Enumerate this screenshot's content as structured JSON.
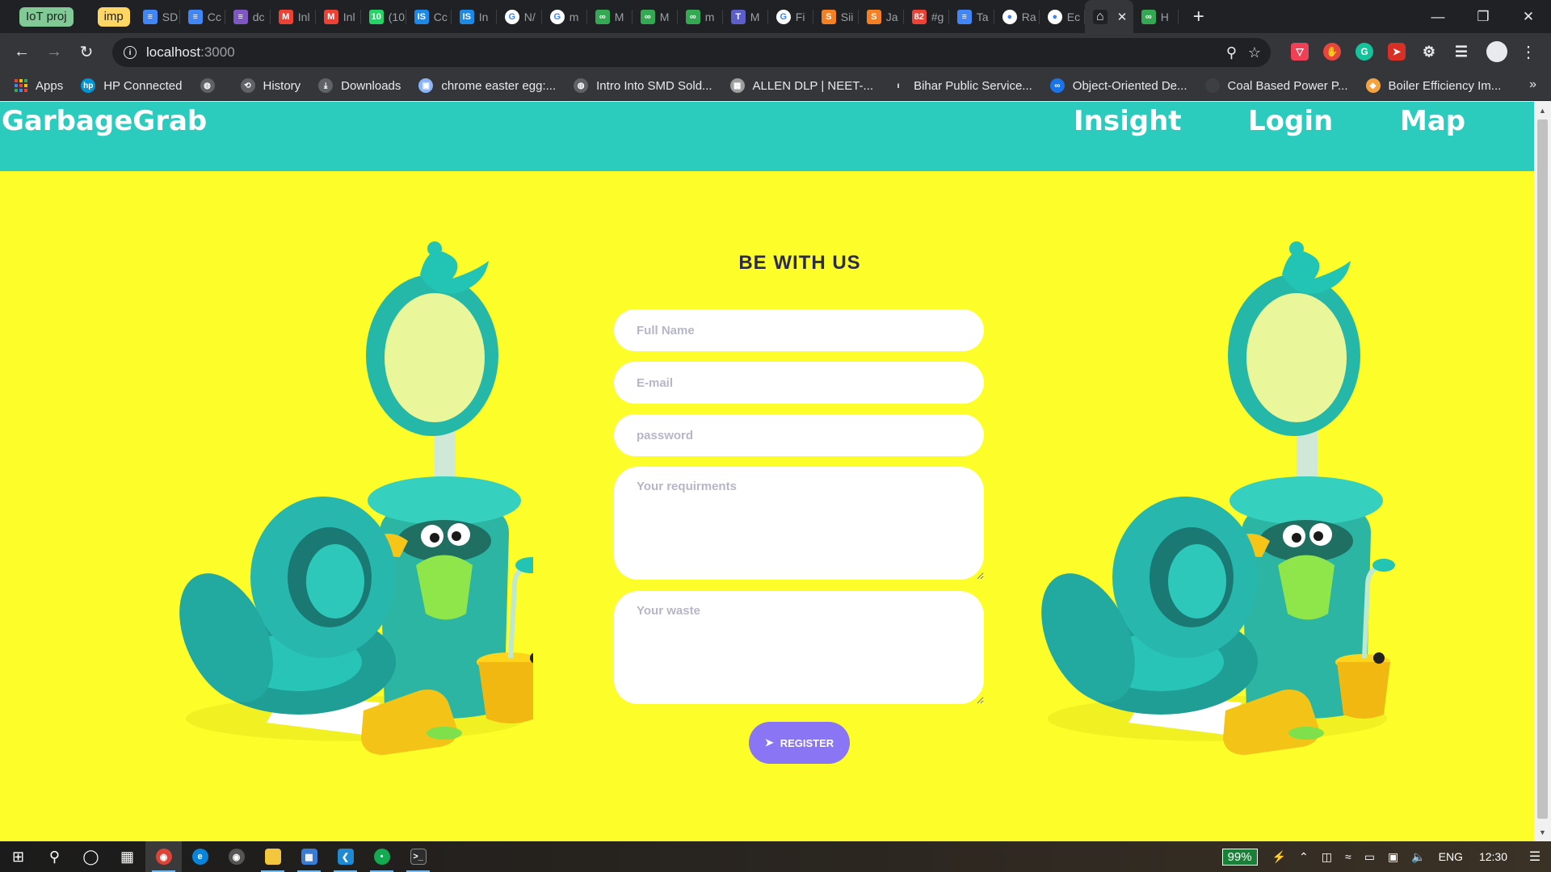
{
  "browser": {
    "tab_groups": [
      "IoT proj",
      "imp"
    ],
    "tabs": [
      {
        "title": "SD",
        "icon": "docs-icon",
        "color": "#4285f4",
        "glyph": "≡"
      },
      {
        "title": "Cc",
        "icon": "docs-icon",
        "color": "#4285f4",
        "glyph": "≡"
      },
      {
        "title": "dc",
        "icon": "forms-icon",
        "color": "#7e57c2",
        "glyph": "≡"
      },
      {
        "title": "Inl",
        "icon": "gmail-icon",
        "color": "#ea4335",
        "glyph": "M"
      },
      {
        "title": "Inl",
        "icon": "gmail-icon",
        "color": "#ea4335",
        "glyph": "M"
      },
      {
        "title": "(10",
        "icon": "whatsapp-icon",
        "color": "#25d366",
        "glyph": "10"
      },
      {
        "title": "Cc",
        "icon": "is-icon",
        "color": "#1e88e5",
        "glyph": "IS"
      },
      {
        "title": "In",
        "icon": "is-icon",
        "color": "#1e88e5",
        "glyph": "IS"
      },
      {
        "title": "N/",
        "icon": "google-icon",
        "color": "#ffffff",
        "glyph": "G"
      },
      {
        "title": "m",
        "icon": "google-icon",
        "color": "#ffffff",
        "glyph": "G"
      },
      {
        "title": "M",
        "icon": "link-icon",
        "color": "#34a853",
        "glyph": "∞"
      },
      {
        "title": "M",
        "icon": "link-icon",
        "color": "#34a853",
        "glyph": "∞"
      },
      {
        "title": "m",
        "icon": "link-icon",
        "color": "#34a853",
        "glyph": "∞"
      },
      {
        "title": "M",
        "icon": "teams-icon",
        "color": "#5b5fc7",
        "glyph": "T"
      },
      {
        "title": "Fi",
        "icon": "google-icon",
        "color": "#ffffff",
        "glyph": "G"
      },
      {
        "title": "Sii",
        "icon": "stackoverflow-icon",
        "color": "#f48024",
        "glyph": "S"
      },
      {
        "title": "Ja",
        "icon": "stackoverflow-icon",
        "color": "#f48024",
        "glyph": "S"
      },
      {
        "title": "#g",
        "icon": "calendar-icon",
        "color": "#ea4335",
        "glyph": "82"
      },
      {
        "title": "Ta",
        "icon": "docs-icon",
        "color": "#4285f4",
        "glyph": "≡"
      },
      {
        "title": "Ra",
        "icon": "github-icon",
        "color": "#ffffff",
        "glyph": "●"
      },
      {
        "title": "Ec",
        "icon": "github-icon",
        "color": "#ffffff",
        "glyph": "●"
      },
      {
        "title": "",
        "icon": "home-icon",
        "color": "#202124",
        "glyph": "⌂",
        "active": true
      },
      {
        "title": "H",
        "icon": "link-icon",
        "color": "#34a853",
        "glyph": "∞"
      }
    ],
    "url_host": "localhost",
    "url_port": ":3000",
    "bookmarks": [
      {
        "label": "Apps",
        "icon": "apps-icon"
      },
      {
        "label": "HP Connected",
        "icon": "hp-icon",
        "color": "#0096d6",
        "glyph": "hp"
      },
      {
        "label": "",
        "icon": "globe-icon",
        "color": "#5f6368",
        "glyph": "◍"
      },
      {
        "label": "History",
        "icon": "history-icon",
        "color": "#5f6368",
        "glyph": "⟲"
      },
      {
        "label": "Downloads",
        "icon": "download-icon",
        "color": "#5f6368",
        "glyph": "⤓"
      },
      {
        "label": "chrome easter egg:...",
        "icon": "image-icon",
        "color": "#8ab4f8",
        "glyph": "▣"
      },
      {
        "label": "Intro Into SMD Sold...",
        "icon": "globe-icon",
        "color": "#5f6368",
        "glyph": "◍"
      },
      {
        "label": "ALLEN DLP | NEET-...",
        "icon": "allen-icon",
        "color": "#9e9e9e",
        "glyph": "▦"
      },
      {
        "label": "Bihar Public Service...",
        "icon": "bpsc-icon",
        "color": "#35363a",
        "glyph": "ı"
      },
      {
        "label": "Object-Oriented De...",
        "icon": "coursera-icon",
        "color": "#1a73e8",
        "glyph": "∞"
      },
      {
        "label": "Coal Based Power P...",
        "icon": "site-icon",
        "color": "#3c4043",
        "glyph": ""
      },
      {
        "label": "Boiler Efficiency Im...",
        "icon": "diamond-icon",
        "color": "#f4a340",
        "glyph": "◆"
      }
    ]
  },
  "site": {
    "brand": "GarbageGrab",
    "nav": [
      "Insight",
      "Login",
      "Map"
    ],
    "form": {
      "title": "BE WITH US",
      "full_name_placeholder": "Full Name",
      "email_placeholder": "E-mail",
      "password_placeholder": "password",
      "requirements_placeholder": "Your requirments",
      "waste_placeholder": "Your waste",
      "register_label": "REGISTER"
    }
  },
  "taskbar": {
    "battery": "99%",
    "language": "ENG",
    "time": "12:30"
  },
  "colors": {
    "page_background": "#fdfd2a",
    "header_background": "#2bcbbe",
    "button": "#8a75f5",
    "title_text": "#2c2c4a"
  }
}
